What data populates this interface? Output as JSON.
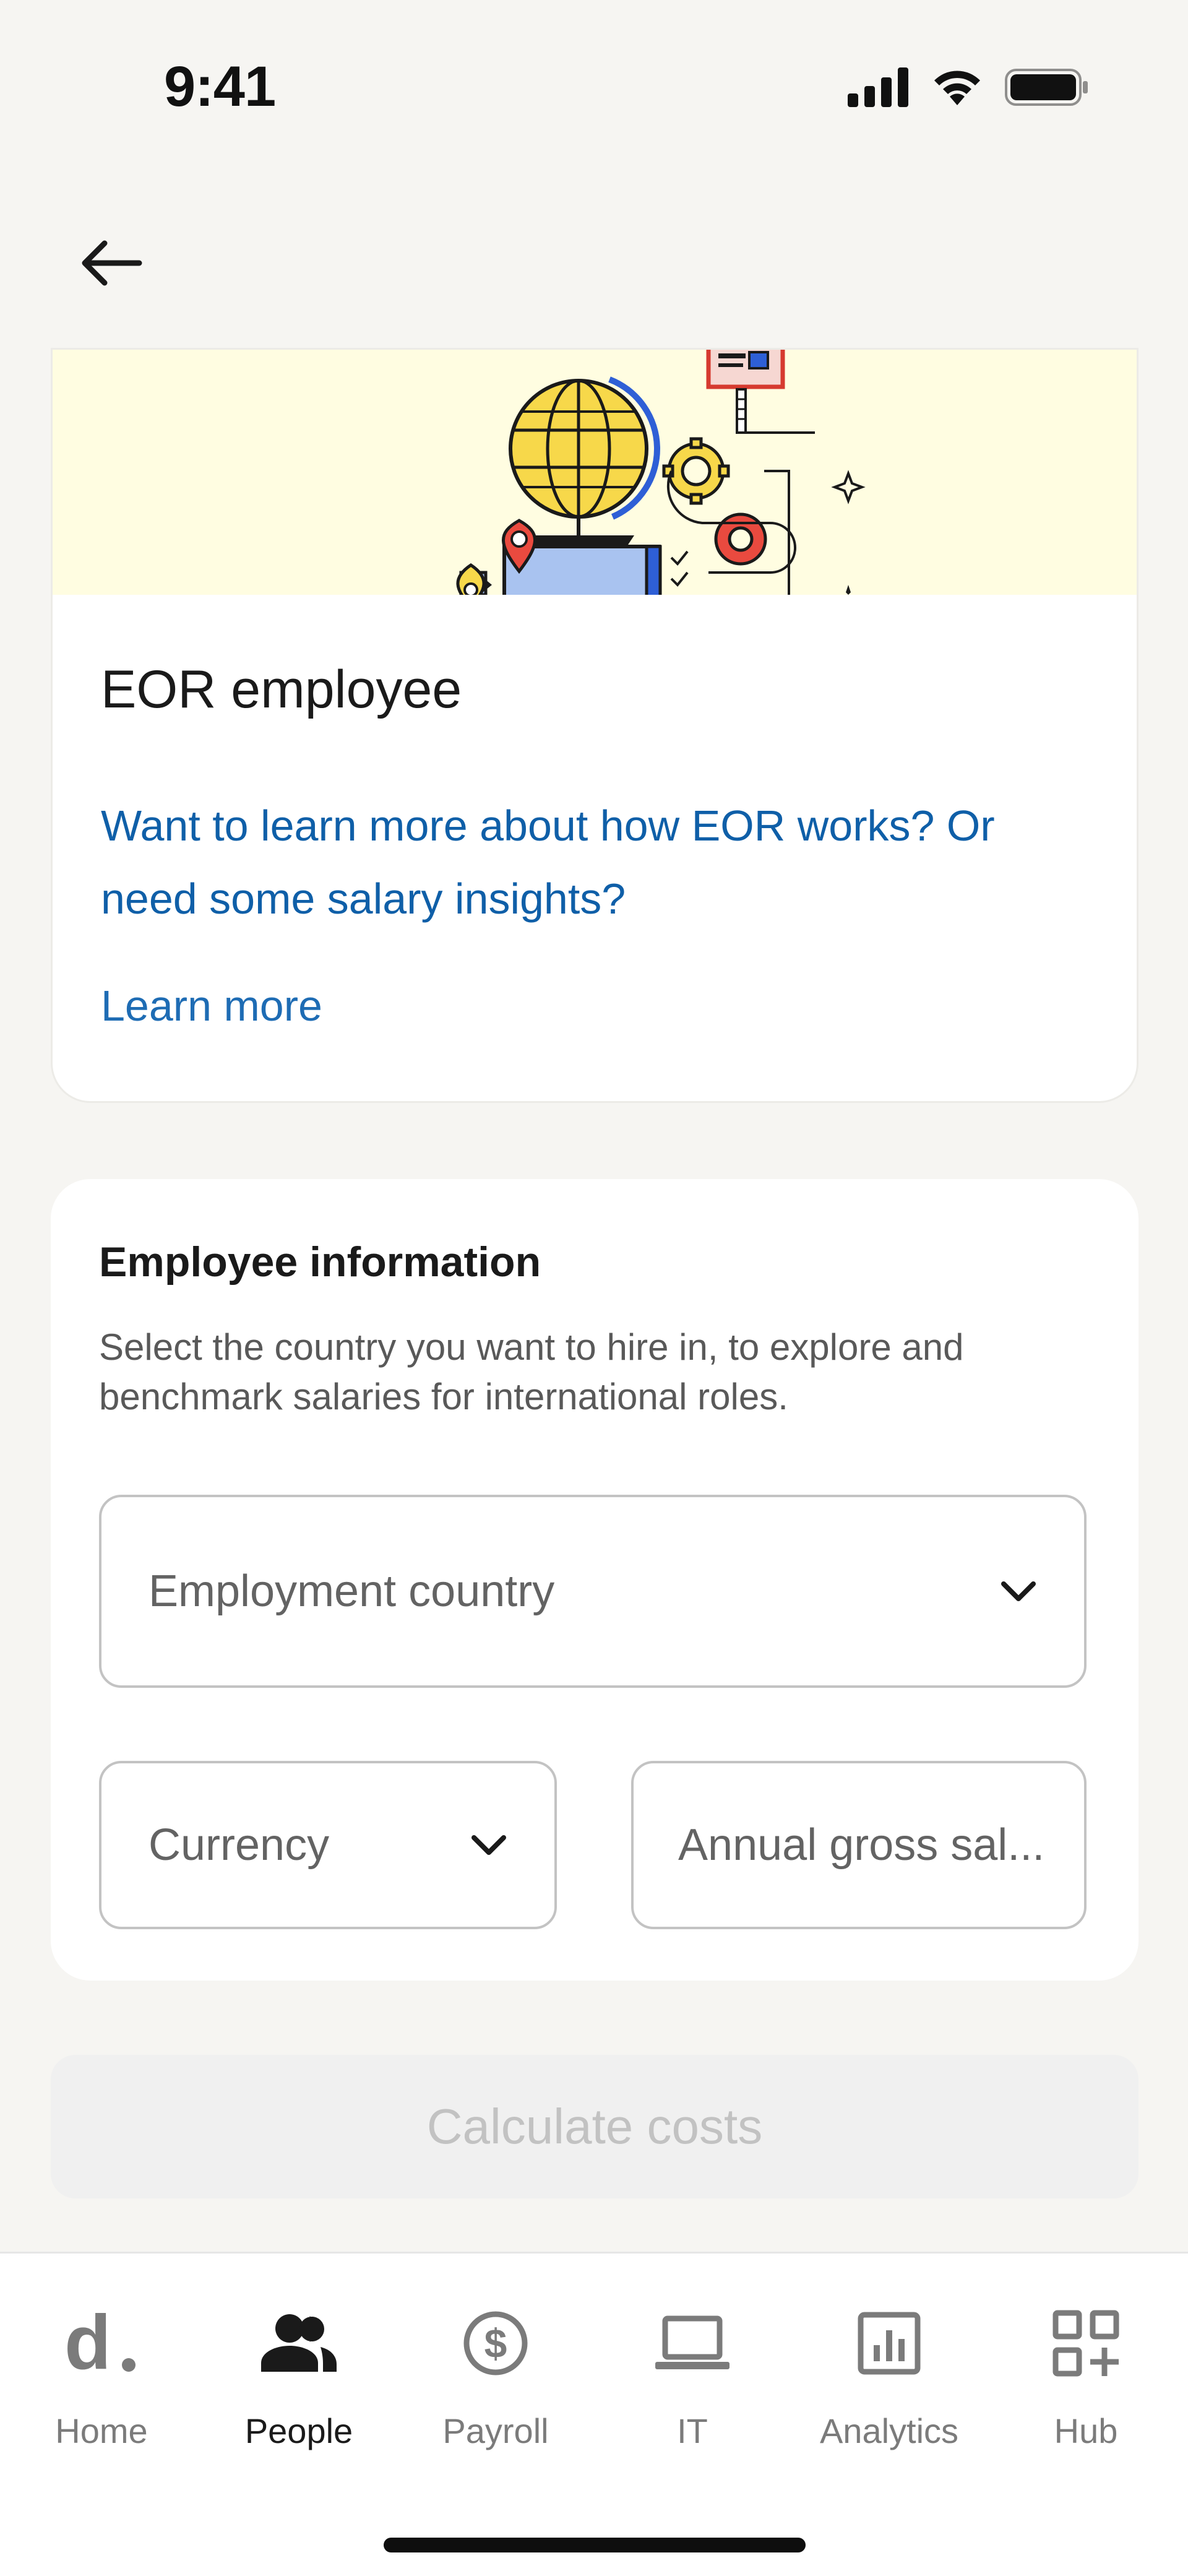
{
  "status_bar": {
    "time": "9:41"
  },
  "eor_card": {
    "title": "EOR employee",
    "description": "Want to learn more about how EOR works? Or need some salary insights?",
    "link_label": "Learn more"
  },
  "employee_info": {
    "title": "Employee information",
    "subtitle": "Select the country you want to hire in, to explore and benchmark salaries for international roles.",
    "country_placeholder": "Employment country",
    "currency_placeholder": "Currency",
    "salary_placeholder": "Annual gross sal..."
  },
  "actions": {
    "calculate_label": "Calculate costs"
  },
  "tabbar": {
    "items": [
      {
        "label": "Home",
        "icon": "deel-logo-icon",
        "active": false
      },
      {
        "label": "People",
        "icon": "people-icon",
        "active": true
      },
      {
        "label": "Payroll",
        "icon": "dollar-icon",
        "active": false
      },
      {
        "label": "IT",
        "icon": "laptop-icon",
        "active": false
      },
      {
        "label": "Analytics",
        "icon": "analytics-icon",
        "active": false
      },
      {
        "label": "Hub",
        "icon": "grid-plus-icon",
        "active": false
      }
    ]
  },
  "colors": {
    "link": "#0f5fa8",
    "banner": "#fffde1",
    "inactive_tab": "#7b7b7b"
  }
}
